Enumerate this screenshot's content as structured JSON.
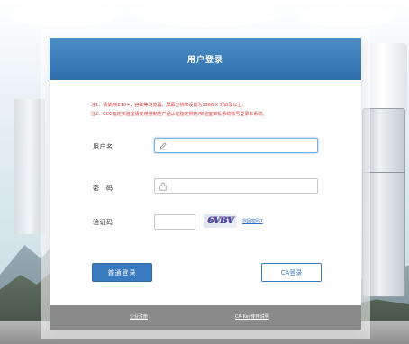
{
  "header": {
    "title": "用户登录"
  },
  "notes": {
    "line1": "注1：请使用IE10+，谷歌等浏览器，屏幕分辨率设置为1366 X 768及以上。",
    "line2_prefix": "注2：CCC指定实验室请使用强制性产品认证指定机构/实验室审批系统账号",
    "line2_link": "登录本系统。"
  },
  "form": {
    "username_label": "用户名",
    "password_label": "密　码",
    "captcha_label": "验证码",
    "username_value": "",
    "password_value": "",
    "captcha_value": "",
    "captcha_text": "6VBV",
    "refresh_link": "找回密码?"
  },
  "buttons": {
    "normal_login": "普通登录",
    "ca_login": "CA登录"
  },
  "footer": {
    "register": "企业注册",
    "ca_key_help": "CA-Key使用说明"
  },
  "colors": {
    "header_blue": "#2f6eab",
    "note_red": "#d83131",
    "button_blue": "#3b7bbf",
    "footer_gray": "#8a8a8a"
  },
  "icons": {
    "username": "pencil-icon",
    "password": "lock-icon"
  }
}
